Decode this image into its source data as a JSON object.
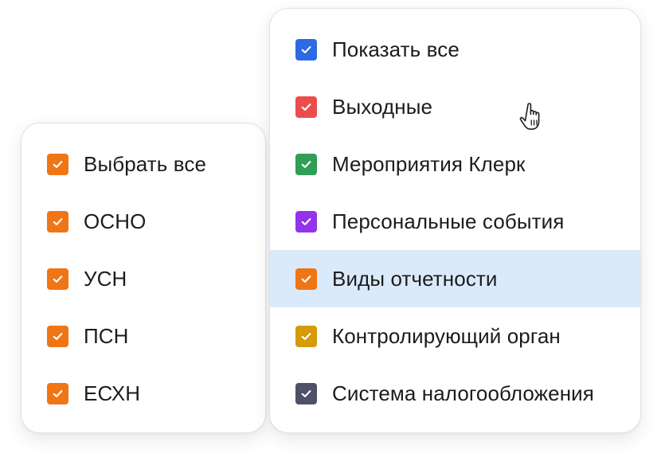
{
  "left_panel": {
    "items": [
      {
        "label": "Выбрать все",
        "color": "#f07515",
        "checked": true
      },
      {
        "label": "ОСНО",
        "color": "#f07515",
        "checked": true
      },
      {
        "label": "УСН",
        "color": "#f07515",
        "checked": true
      },
      {
        "label": "ПСН",
        "color": "#f07515",
        "checked": true
      },
      {
        "label": "ЕСХН",
        "color": "#f07515",
        "checked": true
      }
    ]
  },
  "right_panel": {
    "items": [
      {
        "label": "Показать все",
        "color": "#2d6ae3",
        "checked": true
      },
      {
        "label": "Выходные",
        "color": "#ec4c4c",
        "checked": true
      },
      {
        "label": "Мероприятия Клерк",
        "color": "#2f9e57",
        "checked": true
      },
      {
        "label": "Персональные события",
        "color": "#9333ea",
        "checked": true
      },
      {
        "label": "Виды отчетности",
        "color": "#f07515",
        "checked": true,
        "highlighted": true
      },
      {
        "label": "Контролирующий орган",
        "color": "#d69a06",
        "checked": true
      },
      {
        "label": "Система налогообложения",
        "color": "#4e5168",
        "checked": true
      }
    ]
  },
  "highlight_color": "#dbeafb",
  "icons": {
    "checkmark": "check-icon",
    "cursor": "hand-pointer-icon"
  }
}
